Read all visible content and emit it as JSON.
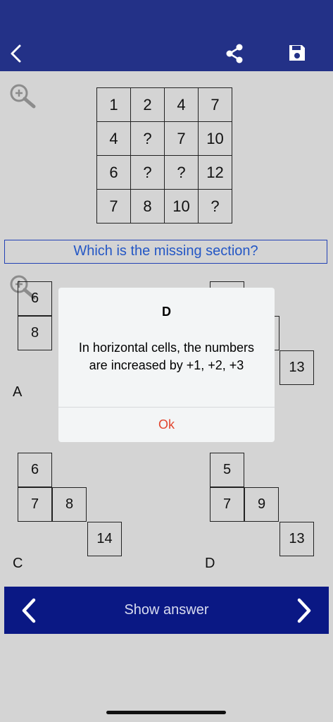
{
  "header": {
    "back_icon": "chevron-left-icon",
    "share_icon": "share-icon",
    "save_icon": "floppy-disk-icon",
    "color": "#233187"
  },
  "puzzle": {
    "zoom_icon": "zoom-in-icon",
    "grid": [
      [
        "1",
        "2",
        "4",
        "7"
      ],
      [
        "4",
        "?",
        "7",
        "10"
      ],
      [
        "6",
        "?",
        "?",
        "12"
      ],
      [
        "7",
        "8",
        "10",
        "?"
      ]
    ]
  },
  "question": {
    "text": "Which is the missing section?"
  },
  "options": {
    "zoom_icon": "zoom-in-icon",
    "A": {
      "label": "A",
      "top": "6",
      "middle": "8"
    },
    "B": {
      "right": "13"
    },
    "C": {
      "label": "C",
      "top": "6",
      "middle_left": "7",
      "middle_right": "8",
      "bottom": "14"
    },
    "D": {
      "label": "D",
      "top": "5",
      "middle_left": "7",
      "middle_right": "9",
      "bottom": "13"
    }
  },
  "dialog": {
    "title": "D",
    "message": "In horizontal cells, the numbers are increased by +1, +2, +3",
    "ok_label": "Ok"
  },
  "bottom_bar": {
    "prev_icon": "chevron-left-icon",
    "next_icon": "chevron-right-icon",
    "show_answer_label": "Show answer",
    "color": "#0a1884"
  }
}
